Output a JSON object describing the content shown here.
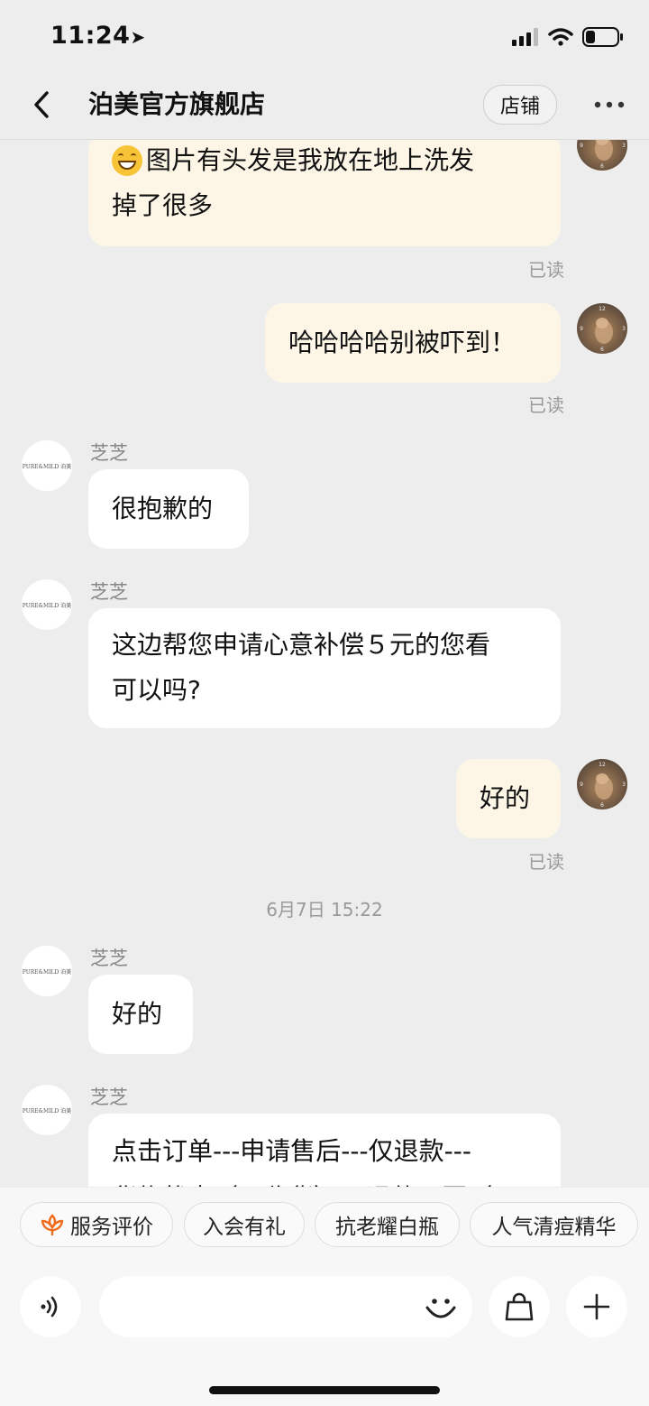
{
  "status_bar": {
    "time": "11:24"
  },
  "nav": {
    "title": "泊美官方旗舰店",
    "shop_label": "店铺"
  },
  "shop_avatar_text": "PURE&MILD 泊美",
  "messages": {
    "m1": {
      "line1": "图片有头发是我放在地上洗发",
      "line2": "掉了很多",
      "read": "已读"
    },
    "m2": {
      "text": "哈哈哈哈别被吓到！",
      "read": "已读"
    },
    "m3": {
      "sender": "芝芝",
      "text": "很抱歉的"
    },
    "m4": {
      "sender": "芝芝",
      "line1": "这边帮您申请心意补偿５元的您看",
      "line2": "可以吗?"
    },
    "m5": {
      "text": "好的",
      "read": "已读"
    },
    "timestamp": "6月7日 15:22",
    "m6": {
      "sender": "芝芝",
      "text": "好的"
    },
    "m7": {
      "sender": "芝芝",
      "line1": "点击订单---申请售后---仅退款---",
      "line2": "货物状态（已收货）---退款原因（"
    }
  },
  "quick_replies": [
    "服务评价",
    "入会有礼",
    "抗老耀白瓶",
    "人气清痘精华"
  ],
  "input": {
    "placeholder": "",
    "value": ""
  }
}
